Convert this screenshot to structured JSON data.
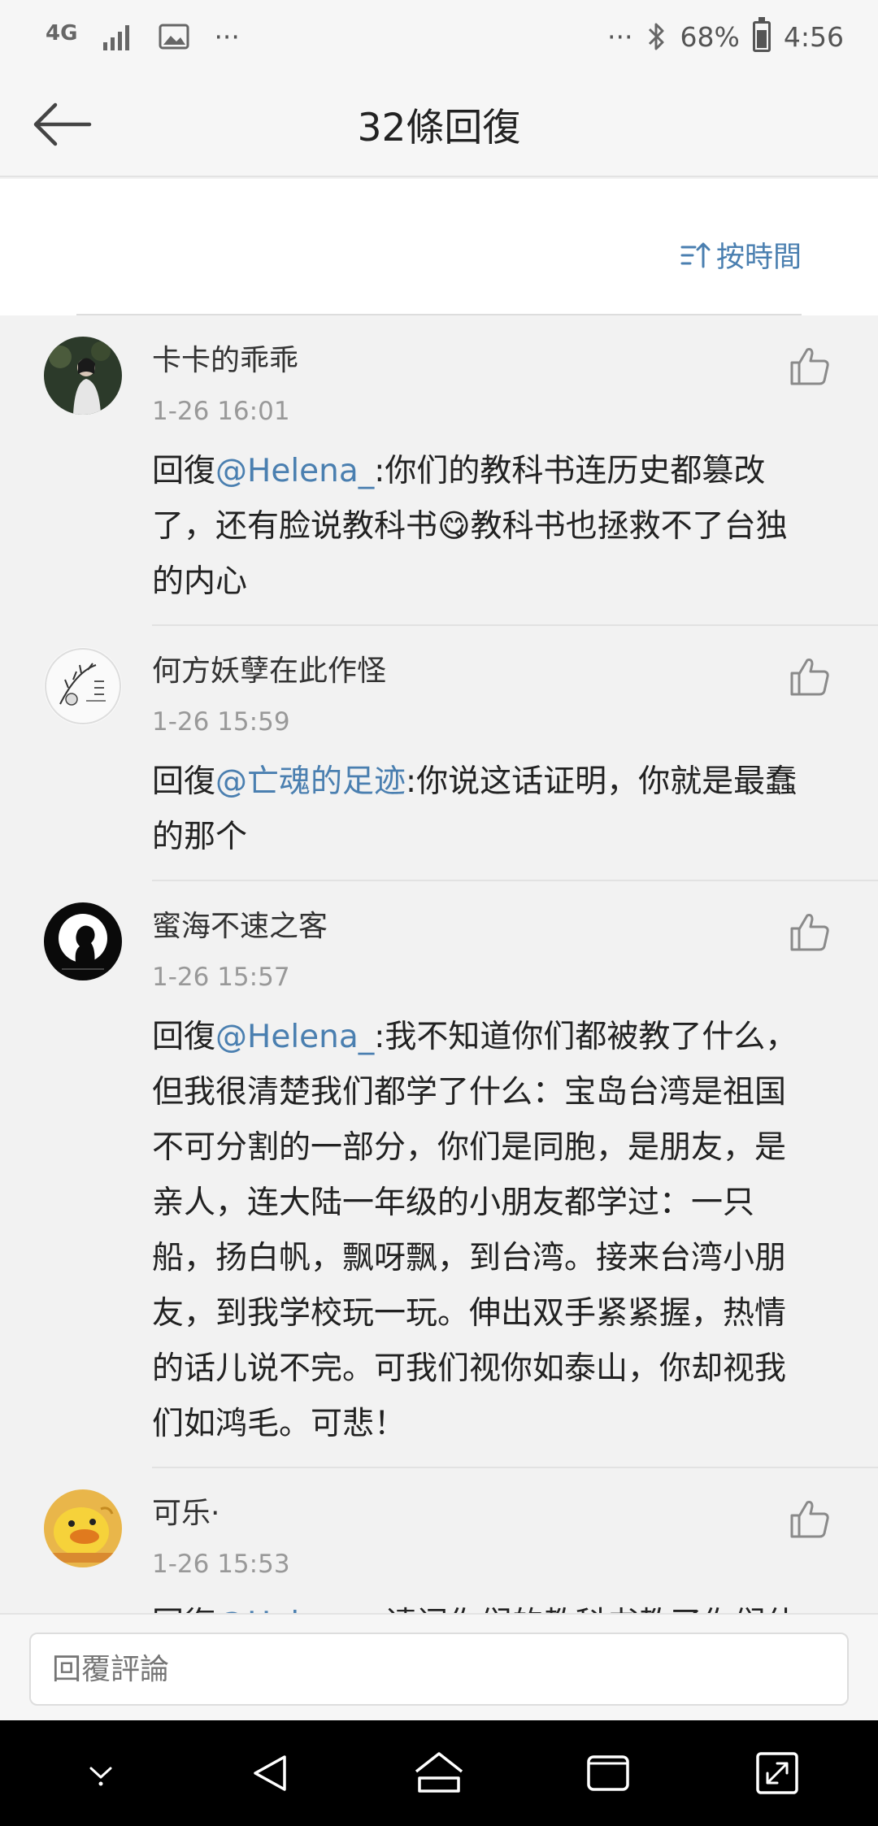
{
  "status_bar": {
    "network": "4G",
    "battery": "68%",
    "battery_level": 0.68,
    "time": "4:56",
    "more_left": "···",
    "more_right": "···"
  },
  "header": {
    "title": "32條回復"
  },
  "sort": {
    "label": "按時間"
  },
  "comments": [
    {
      "name": "卡卡的乖乖",
      "time": "1-26 16:01",
      "prefix": "回復",
      "mention": "@Helena_",
      "text": ":你们的教科书连历史都篡改了，还有脸说教科书😋教科书也拯救不了台独的内心"
    },
    {
      "name": "何方妖孽在此作怪",
      "time": "1-26 15:59",
      "prefix": "回復",
      "mention": "@亡魂的足迹",
      "text": ":你说这话证明，你就是最蠢的那个"
    },
    {
      "name": "蜜海不速之客",
      "time": "1-26 15:57",
      "prefix": "回復",
      "mention": "@Helena_",
      "text": ":我不知道你们都被教了什么，但我很清楚我们都学了什么：宝岛台湾是祖国不可分割的一部分，你们是同胞，是朋友，是亲人，连大陆一年级的小朋友都学过：一只船，扬白帆，飘呀飘，到台湾。接来台湾小朋友，到我学校玩一玩。伸出双手紧紧握，热情的话儿说不完。可我们视你如泰山，你却视我们如鸿毛。可悲！"
    },
    {
      "name": "可乐·",
      "time": "1-26 15:53",
      "prefix": "回復",
      "mention": "@Helena_",
      "text": ":请问你们的教科书教了你们什"
    }
  ],
  "reply": {
    "placeholder": "回覆評論"
  },
  "colors": {
    "accent": "#4a7fb0",
    "background": "#f2f2f2",
    "nav_bar": "#000000"
  }
}
